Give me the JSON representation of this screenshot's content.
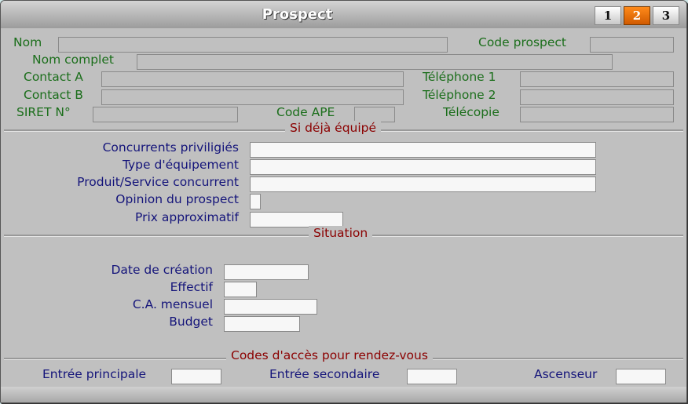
{
  "window": {
    "title": "Prospect",
    "tabs": [
      {
        "label": "1",
        "active": false
      },
      {
        "label": "2",
        "active": true
      },
      {
        "label": "3",
        "active": false
      }
    ]
  },
  "identity": {
    "nom": {
      "label": "Nom",
      "value": ""
    },
    "code_prospect": {
      "label": "Code prospect",
      "value": ""
    },
    "nom_complet": {
      "label": "Nom complet",
      "value": ""
    },
    "contact_a": {
      "label": "Contact A",
      "value": ""
    },
    "telephone_1": {
      "label": "Téléphone 1",
      "value": ""
    },
    "contact_b": {
      "label": "Contact B",
      "value": ""
    },
    "telephone_2": {
      "label": "Téléphone 2",
      "value": ""
    },
    "siret": {
      "label": "SIRET N°",
      "value": ""
    },
    "code_ape": {
      "label": "Code APE",
      "value": ""
    },
    "telecopie": {
      "label": "Télécopie",
      "value": ""
    }
  },
  "equipement": {
    "section_title": "Si déjà équipé",
    "concurrents": {
      "label": "Concurrents priviligiés",
      "value": ""
    },
    "type_equipement": {
      "label": "Type d'équipement",
      "value": ""
    },
    "produit_service": {
      "label": "Produit/Service concurrent",
      "value": ""
    },
    "opinion": {
      "label": "Opinion du prospect",
      "value": ""
    },
    "prix": {
      "label": "Prix approximatif",
      "value": ""
    }
  },
  "situation": {
    "section_title": "Situation",
    "date_creation": {
      "label": "Date de création",
      "value": ""
    },
    "effectif": {
      "label": "Effectif",
      "value": ""
    },
    "ca_mensuel": {
      "label": "C.A. mensuel",
      "value": ""
    },
    "budget": {
      "label": "Budget",
      "value": ""
    }
  },
  "acces": {
    "section_title": "Codes d'accès pour rendez-vous",
    "entree_principale": {
      "label": "Entrée principale",
      "value": ""
    },
    "entree_secondaire": {
      "label": "Entrée secondaire",
      "value": ""
    },
    "ascenseur": {
      "label": "Ascenseur",
      "value": ""
    }
  }
}
